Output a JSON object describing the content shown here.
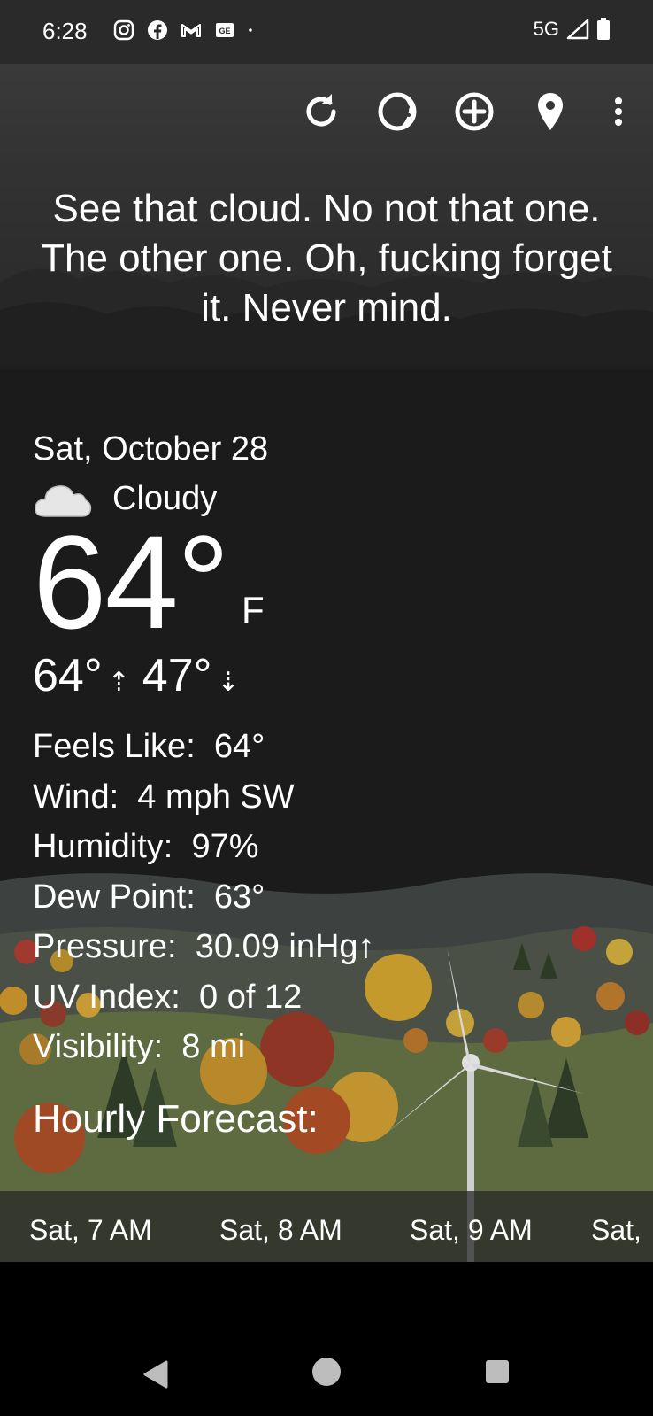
{
  "status": {
    "time": "6:28",
    "network": "5G",
    "icons": [
      "instagram-icon",
      "facebook-icon",
      "gmail-icon",
      "news-icon",
      "dot-icon"
    ]
  },
  "toolbar": {
    "icons": [
      "refresh-icon",
      "theme-icon",
      "add-location-icon",
      "location-pin-icon",
      "more-vert-icon"
    ]
  },
  "quote": "See that cloud. No not that one. The other one. Oh, fucking forget it. Never mind.",
  "weather": {
    "date": "Sat, October 28",
    "condition": "Cloudy",
    "temp": "64°",
    "unit": "F",
    "high": "64°",
    "low": "47°",
    "details": [
      {
        "label": "Feels Like:",
        "value": "64°"
      },
      {
        "label": "Wind:",
        "value": "4 mph SW"
      },
      {
        "label": "Humidity:",
        "value": "97%"
      },
      {
        "label": "Dew Point:",
        "value": "63°"
      },
      {
        "label": "Pressure:",
        "value": "30.09 inHg↑"
      },
      {
        "label": "UV Index:",
        "value": "0 of 12"
      },
      {
        "label": "Visibility:",
        "value": "8 mi"
      }
    ],
    "hourly_title": "Hourly Forecast:",
    "hourly": [
      "Sat, 7 AM",
      "Sat, 8 AM",
      "Sat, 9 AM",
      "Sat,"
    ]
  },
  "colors": {
    "background": "#1b1b1b",
    "toolbar": "#363636",
    "text": "#ffffff"
  }
}
